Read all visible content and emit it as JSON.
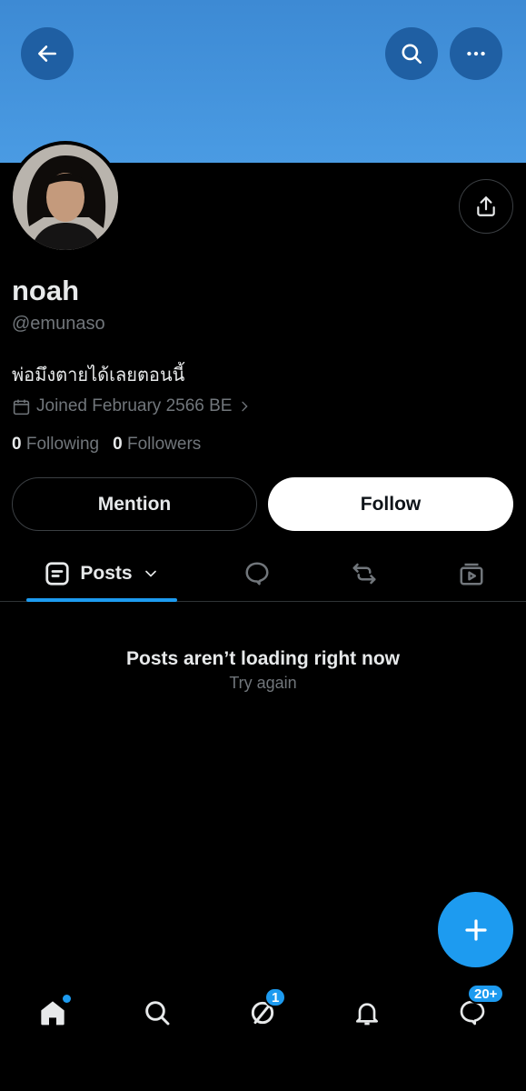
{
  "header": {
    "back_icon": "arrow-left-icon",
    "search_icon": "search-icon",
    "more_icon": "more-horizontal-icon",
    "banner_color": "#4a9be3"
  },
  "profile": {
    "name": "noah",
    "handle": "@emunaso",
    "bio": "พ่อมึงตายได้เลยตอนนี้",
    "joined": "Joined February 2566 BE",
    "following_count": "0",
    "following_label": "Following",
    "followers_count": "0",
    "followers_label": "Followers"
  },
  "actions": {
    "mention_label": "Mention",
    "follow_label": "Follow"
  },
  "tabs": {
    "posts_label": "Posts",
    "items": [
      "posts",
      "replies",
      "reposts",
      "media"
    ]
  },
  "feed": {
    "error_title": "Posts aren’t loading right now",
    "retry_label": "Try again"
  },
  "bottom_nav": {
    "messages_badge": "1",
    "chat_badge": "20+"
  },
  "colors": {
    "accent": "#1d9bf0",
    "background": "#000000",
    "muted_text": "#71767b"
  }
}
